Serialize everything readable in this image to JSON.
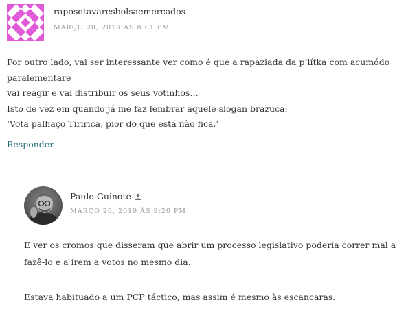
{
  "comment1": {
    "author": "raposotavaresbolsaemercados",
    "date": "MARÇO 20, 2019 ÀS 8:01 PM",
    "lines": [
      "Por outro lado, vai ser interessante ver como é que a rapaziada da p’lítka com acumódo paralementare",
      "vai reagir e vai distribuir os seus votinhos…",
      "Isto de vez em quando já me faz lembrar aquele slogan brazuca:",
      "‘Vota palhaço Tiririca, pior do que está não fica,’"
    ],
    "reply_label": "Responder",
    "avatar_icon": "identicon-avatar",
    "avatar_color": "#e05ad8"
  },
  "comment2": {
    "author": "Paulo Guinote",
    "author_badge_icon": "person-icon",
    "date": "MARÇO 20, 2019 ÀS 9:20 PM",
    "paragraphs": [
      "E ver os cromos que disseram que abrir um processo legislativo poderia correr mal a fazê-lo e a irem a votos no mesmo dia.",
      "Estava habituado a um PCP táctico, mas assim é mesmo às escancaras."
    ],
    "avatar_icon": "profile-photo-avatar"
  },
  "colors": {
    "link": "#1e6f78",
    "meta": "#9a9a9a",
    "text": "#333333"
  }
}
